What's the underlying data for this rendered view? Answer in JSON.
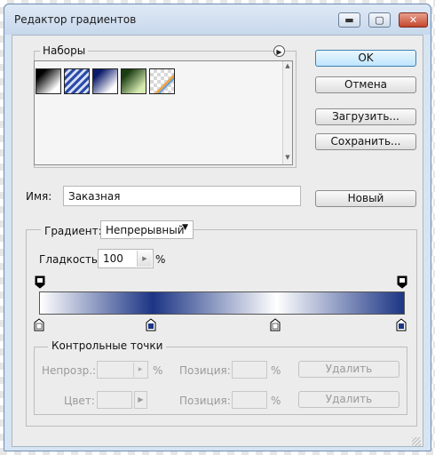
{
  "window": {
    "title": "Редактор градиентов",
    "minimize": "▬",
    "maximize": "▢",
    "close": "✕"
  },
  "presets": {
    "label": "Наборы",
    "items": [
      {
        "name": "foreground-to-background"
      },
      {
        "name": "blue-stripes"
      },
      {
        "name": "blue-gradient"
      },
      {
        "name": "green-gradient"
      },
      {
        "name": "transparent-stripes"
      }
    ]
  },
  "buttons": {
    "ok": "OK",
    "cancel": "Отмена",
    "load": "Загрузить...",
    "save": "Сохранить...",
    "new": "Новый"
  },
  "name": {
    "label": "Имя:",
    "value": "Заказная"
  },
  "gradient": {
    "type_label": "Градиент:",
    "type_value": "Непрерывный",
    "smoothness_label": "Гладкость:",
    "smoothness_value": "100",
    "smoothness_unit": "%",
    "colors": {
      "dark": "#1c3585",
      "light": "#ffffff"
    }
  },
  "stops": {
    "label": "Контрольные точки",
    "opacity_label": "Непрозр.:",
    "opacity_unit": "%",
    "position_label_1": "Позиция:",
    "position_unit_1": "%",
    "delete_1": "Удалить",
    "color_label": "Цвет:",
    "position_label_2": "Позиция:",
    "position_unit_2": "%",
    "delete_2": "Удалить"
  }
}
